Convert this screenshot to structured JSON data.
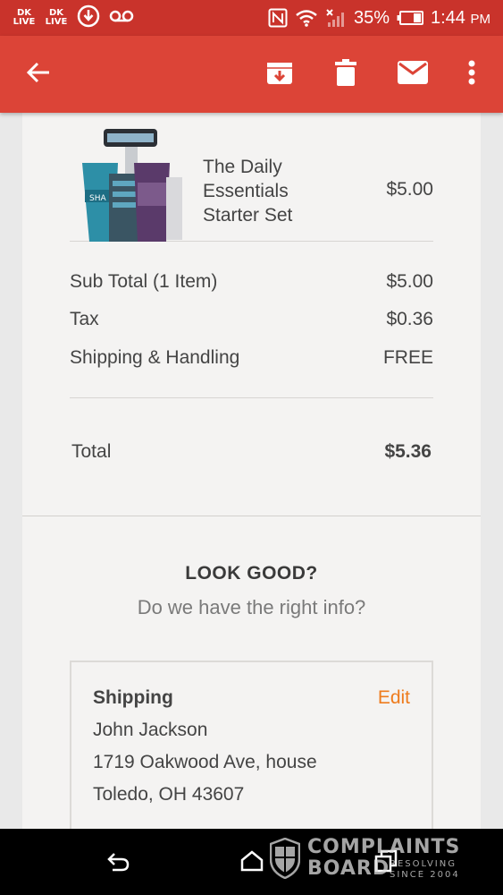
{
  "status_bar": {
    "left_badges": [
      "DK LIVE",
      "DK LIVE"
    ],
    "battery_percent": "35%",
    "time": "1:44",
    "time_suffix": "PM"
  },
  "app_bar": {
    "icons": [
      "back-arrow-icon",
      "archive-icon",
      "delete-icon",
      "mail-icon",
      "more-vert-icon"
    ],
    "color": "#dc4437"
  },
  "order": {
    "product": {
      "name_lines": [
        "The Daily",
        "Essentials",
        "Starter Set"
      ],
      "price": "$5.00"
    },
    "summary": [
      {
        "label": "Sub Total (1 Item)",
        "value": "$5.00"
      },
      {
        "label": "Tax",
        "value": "$0.36"
      },
      {
        "label": "Shipping & Handling",
        "value": "FREE"
      }
    ],
    "total": {
      "label": "Total",
      "value": "$5.36"
    }
  },
  "confirm": {
    "title": "LOOK GOOD?",
    "subtitle": "Do we have the right info?"
  },
  "shipping": {
    "heading": "Shipping",
    "edit_label": "Edit",
    "edit_color": "#ee7c1e",
    "name": "John Jackson",
    "address_line1": "1719 Oakwood Ave, house",
    "address_line2": "Toledo, OH 43607"
  },
  "watermark": {
    "line1": "COMPLAINTS",
    "line2": "BOARD",
    "tag1": "RESOLVING",
    "tag2": "SINCE 2004"
  }
}
